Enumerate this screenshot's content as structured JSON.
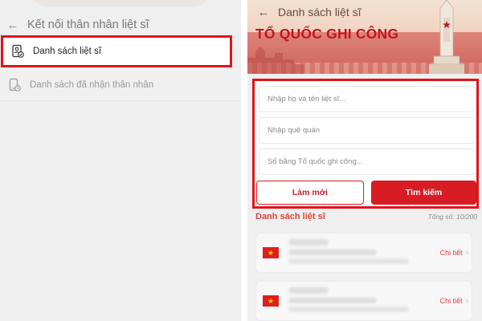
{
  "left": {
    "title": "Kết nối thân nhân liệt sĩ",
    "menu": [
      {
        "label": "Danh sách liệt sĩ",
        "icon": "id-check-icon",
        "highlighted": true
      },
      {
        "label": "Danh sách đã nhận thân nhân",
        "icon": "phone-check-icon",
        "highlighted": false
      }
    ]
  },
  "right": {
    "title": "Danh sách liệt sĩ",
    "banner_heading": "TỔ QUỐC GHI CÔNG",
    "search": {
      "name_placeholder": "Nhập họ và tên liệt sĩ...",
      "hometown_placeholder": "Nhập quê quán",
      "certificate_placeholder": "Số bằng Tổ quốc ghi công...",
      "reset_label": "Làm mới",
      "search_label": "Tìm kiếm"
    },
    "list": {
      "title": "Danh sách liệt sĩ",
      "count": "Tổng số: 10/200",
      "items": [
        {
          "detail_label": "Chi tiết"
        },
        {
          "detail_label": "Chi tiết"
        }
      ]
    }
  },
  "colors": {
    "accent": "#d71c24",
    "highlight_border": "#e0141b",
    "background": "#efefef"
  }
}
